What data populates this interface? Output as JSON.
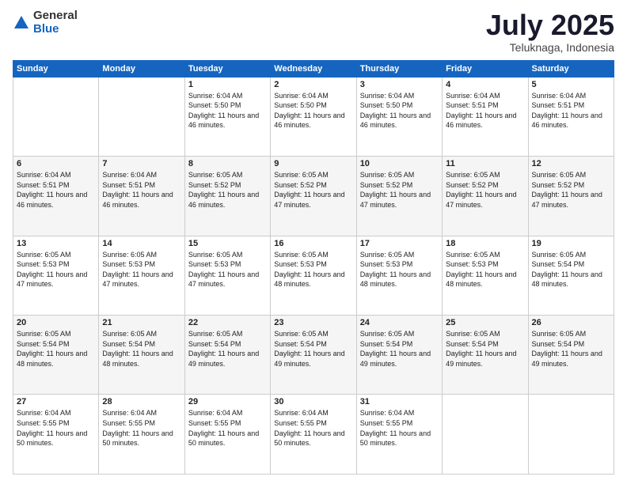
{
  "logo": {
    "general": "General",
    "blue": "Blue"
  },
  "header": {
    "month": "July 2025",
    "location": "Teluknaga, Indonesia"
  },
  "weekdays": [
    "Sunday",
    "Monday",
    "Tuesday",
    "Wednesday",
    "Thursday",
    "Friday",
    "Saturday"
  ],
  "weeks": [
    [
      null,
      null,
      {
        "day": 1,
        "sunrise": "6:04 AM",
        "sunset": "5:50 PM",
        "daylight": "11 hours and 46 minutes."
      },
      {
        "day": 2,
        "sunrise": "6:04 AM",
        "sunset": "5:50 PM",
        "daylight": "11 hours and 46 minutes."
      },
      {
        "day": 3,
        "sunrise": "6:04 AM",
        "sunset": "5:50 PM",
        "daylight": "11 hours and 46 minutes."
      },
      {
        "day": 4,
        "sunrise": "6:04 AM",
        "sunset": "5:51 PM",
        "daylight": "11 hours and 46 minutes."
      },
      {
        "day": 5,
        "sunrise": "6:04 AM",
        "sunset": "5:51 PM",
        "daylight": "11 hours and 46 minutes."
      }
    ],
    [
      {
        "day": 6,
        "sunrise": "6:04 AM",
        "sunset": "5:51 PM",
        "daylight": "11 hours and 46 minutes."
      },
      {
        "day": 7,
        "sunrise": "6:04 AM",
        "sunset": "5:51 PM",
        "daylight": "11 hours and 46 minutes."
      },
      {
        "day": 8,
        "sunrise": "6:05 AM",
        "sunset": "5:52 PM",
        "daylight": "11 hours and 46 minutes."
      },
      {
        "day": 9,
        "sunrise": "6:05 AM",
        "sunset": "5:52 PM",
        "daylight": "11 hours and 47 minutes."
      },
      {
        "day": 10,
        "sunrise": "6:05 AM",
        "sunset": "5:52 PM",
        "daylight": "11 hours and 47 minutes."
      },
      {
        "day": 11,
        "sunrise": "6:05 AM",
        "sunset": "5:52 PM",
        "daylight": "11 hours and 47 minutes."
      },
      {
        "day": 12,
        "sunrise": "6:05 AM",
        "sunset": "5:52 PM",
        "daylight": "11 hours and 47 minutes."
      }
    ],
    [
      {
        "day": 13,
        "sunrise": "6:05 AM",
        "sunset": "5:53 PM",
        "daylight": "11 hours and 47 minutes."
      },
      {
        "day": 14,
        "sunrise": "6:05 AM",
        "sunset": "5:53 PM",
        "daylight": "11 hours and 47 minutes."
      },
      {
        "day": 15,
        "sunrise": "6:05 AM",
        "sunset": "5:53 PM",
        "daylight": "11 hours and 47 minutes."
      },
      {
        "day": 16,
        "sunrise": "6:05 AM",
        "sunset": "5:53 PM",
        "daylight": "11 hours and 48 minutes."
      },
      {
        "day": 17,
        "sunrise": "6:05 AM",
        "sunset": "5:53 PM",
        "daylight": "11 hours and 48 minutes."
      },
      {
        "day": 18,
        "sunrise": "6:05 AM",
        "sunset": "5:53 PM",
        "daylight": "11 hours and 48 minutes."
      },
      {
        "day": 19,
        "sunrise": "6:05 AM",
        "sunset": "5:54 PM",
        "daylight": "11 hours and 48 minutes."
      }
    ],
    [
      {
        "day": 20,
        "sunrise": "6:05 AM",
        "sunset": "5:54 PM",
        "daylight": "11 hours and 48 minutes."
      },
      {
        "day": 21,
        "sunrise": "6:05 AM",
        "sunset": "5:54 PM",
        "daylight": "11 hours and 48 minutes."
      },
      {
        "day": 22,
        "sunrise": "6:05 AM",
        "sunset": "5:54 PM",
        "daylight": "11 hours and 49 minutes."
      },
      {
        "day": 23,
        "sunrise": "6:05 AM",
        "sunset": "5:54 PM",
        "daylight": "11 hours and 49 minutes."
      },
      {
        "day": 24,
        "sunrise": "6:05 AM",
        "sunset": "5:54 PM",
        "daylight": "11 hours and 49 minutes."
      },
      {
        "day": 25,
        "sunrise": "6:05 AM",
        "sunset": "5:54 PM",
        "daylight": "11 hours and 49 minutes."
      },
      {
        "day": 26,
        "sunrise": "6:05 AM",
        "sunset": "5:54 PM",
        "daylight": "11 hours and 49 minutes."
      }
    ],
    [
      {
        "day": 27,
        "sunrise": "6:04 AM",
        "sunset": "5:55 PM",
        "daylight": "11 hours and 50 minutes."
      },
      {
        "day": 28,
        "sunrise": "6:04 AM",
        "sunset": "5:55 PM",
        "daylight": "11 hours and 50 minutes."
      },
      {
        "day": 29,
        "sunrise": "6:04 AM",
        "sunset": "5:55 PM",
        "daylight": "11 hours and 50 minutes."
      },
      {
        "day": 30,
        "sunrise": "6:04 AM",
        "sunset": "5:55 PM",
        "daylight": "11 hours and 50 minutes."
      },
      {
        "day": 31,
        "sunrise": "6:04 AM",
        "sunset": "5:55 PM",
        "daylight": "11 hours and 50 minutes."
      },
      null,
      null
    ]
  ],
  "labels": {
    "sunrise_prefix": "Sunrise: ",
    "sunset_prefix": "Sunset: ",
    "daylight_prefix": "Daylight: "
  }
}
